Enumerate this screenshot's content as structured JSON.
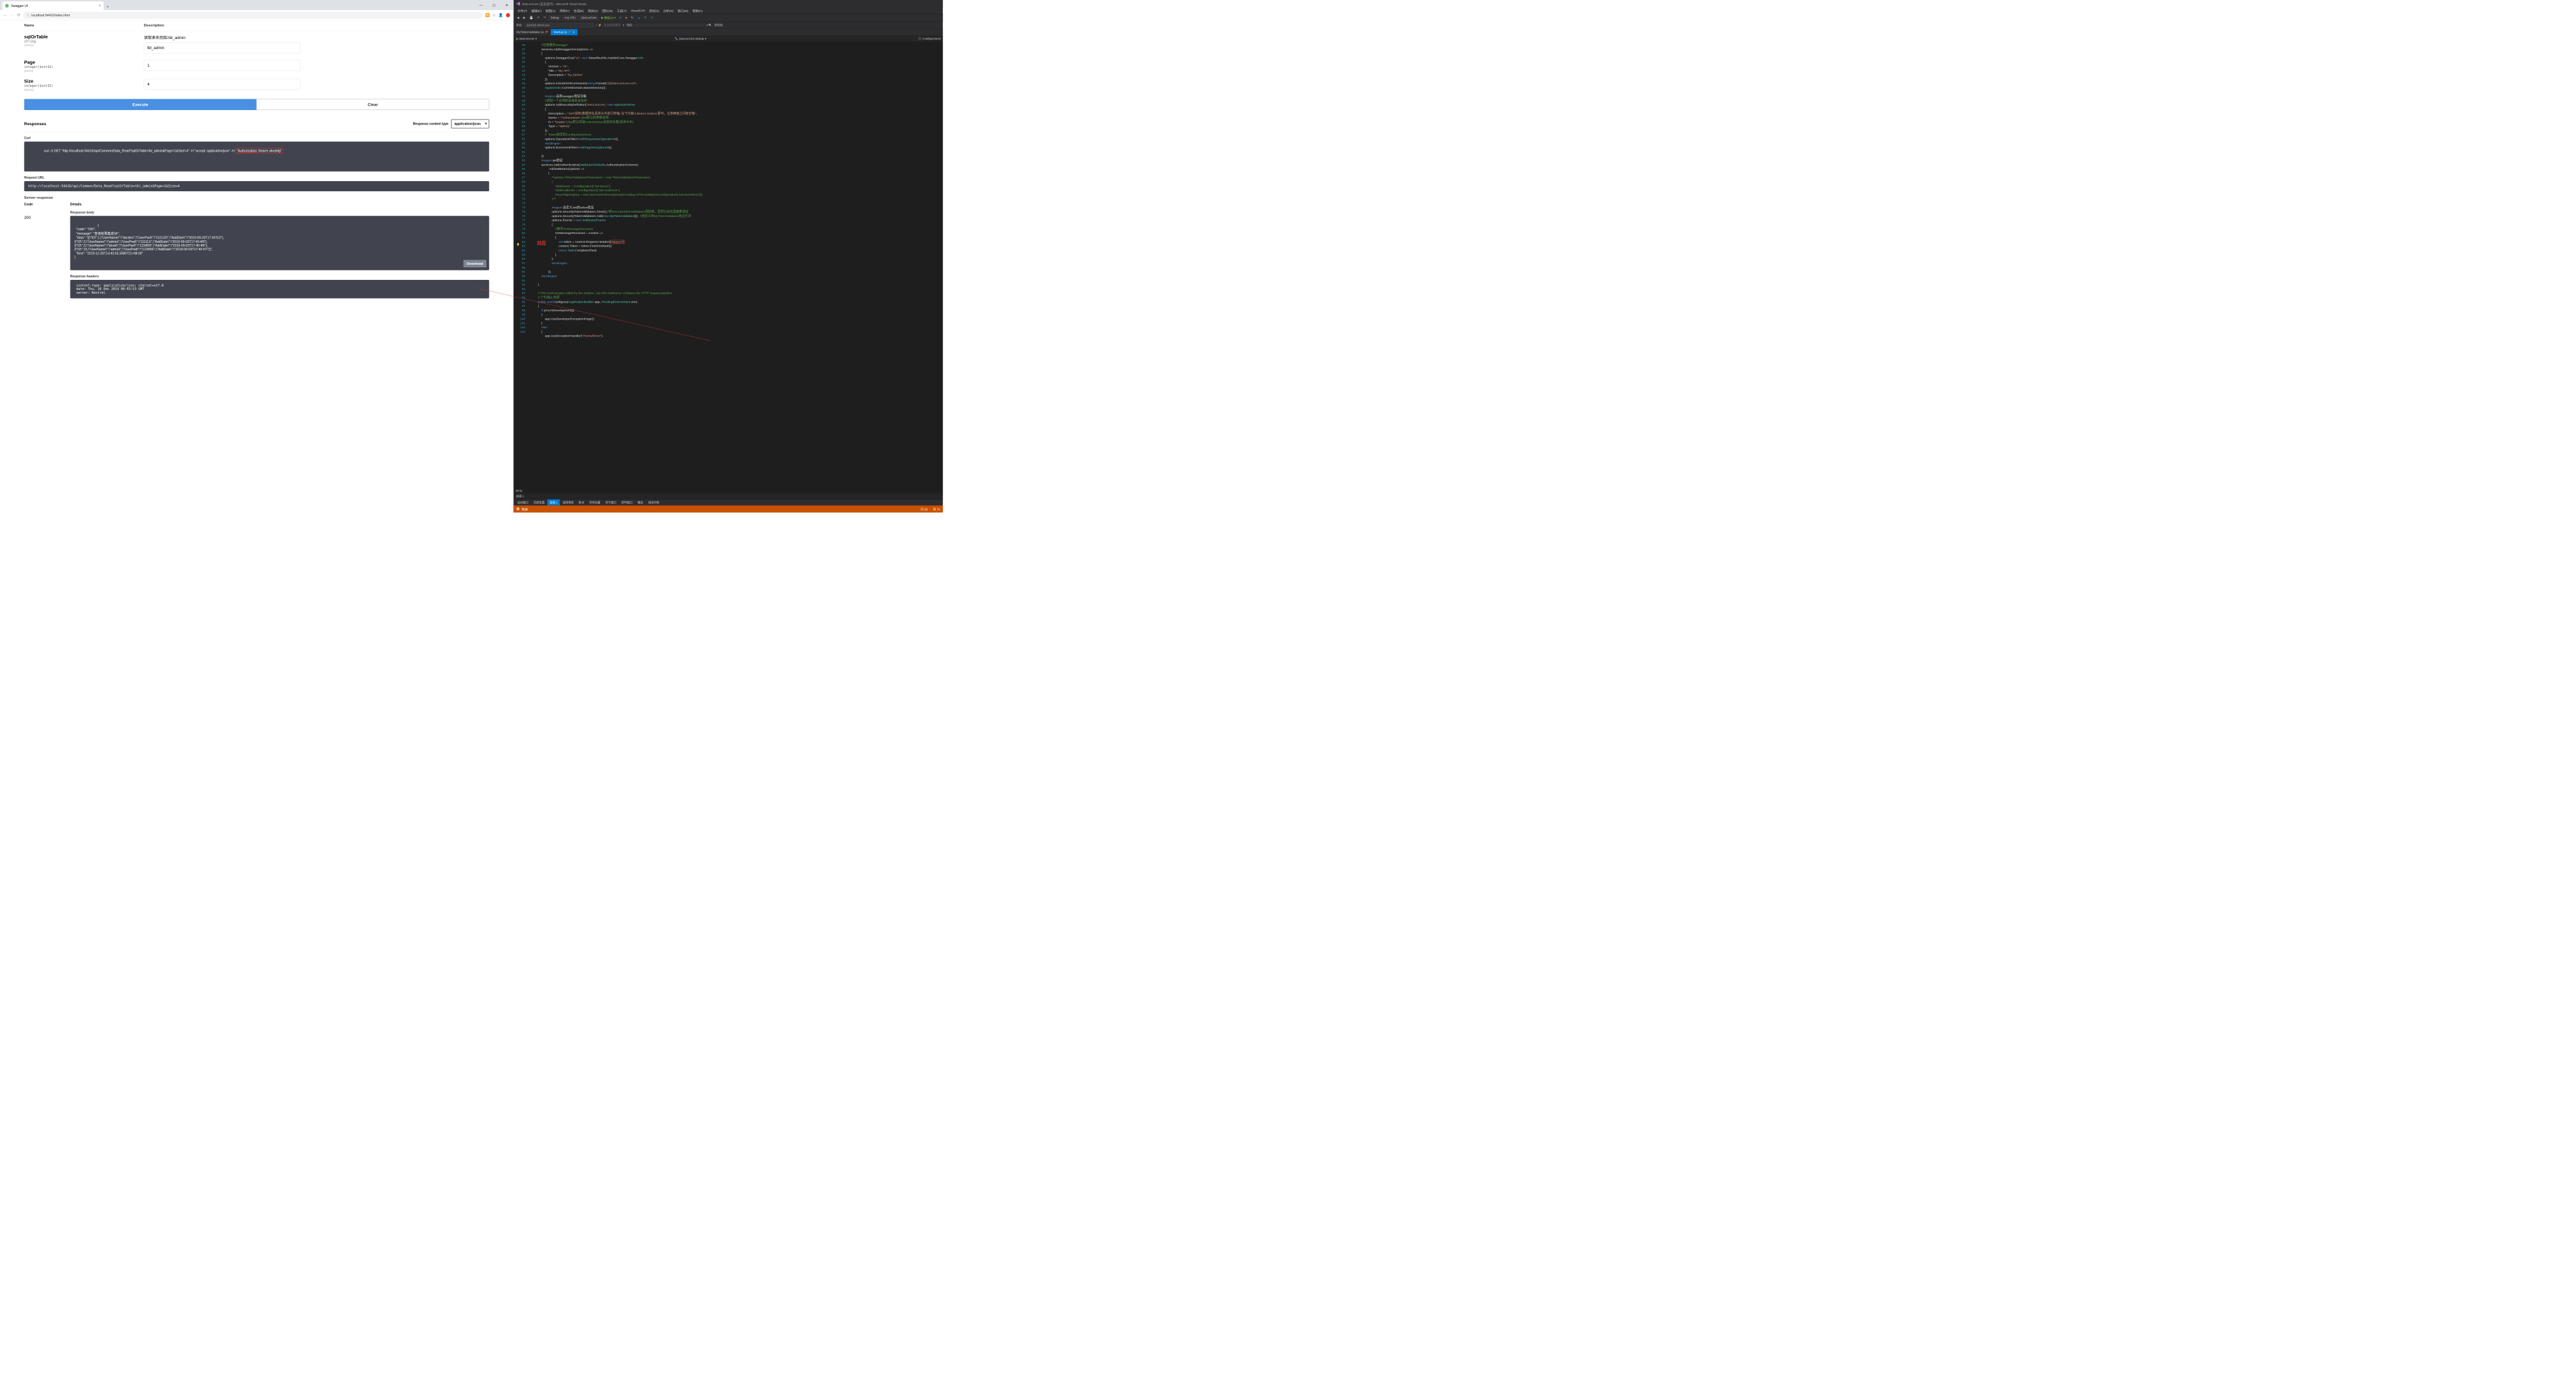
{
  "browser": {
    "tab_title": "Swagger UI",
    "url_secure_text": "ⓘ",
    "url": "localhost:54410/index.html"
  },
  "swagger": {
    "th_name": "Name",
    "th_desc": "Description",
    "params": [
      {
        "name": "sqlOrTable",
        "type": "string",
        "in": "(query)",
        "desc": "读取表名例如:tbl_admin",
        "value": "tbl_admin"
      },
      {
        "name": "Page",
        "type": "integer($int32)",
        "in": "(query)",
        "desc": "",
        "value": "1"
      },
      {
        "name": "Size",
        "type": "integer($int32)",
        "in": "(query)",
        "desc": "",
        "value": "4"
      }
    ],
    "execute": "Execute",
    "clear": "Clear",
    "responses_title": "Responses",
    "rct_label": "Response content type",
    "rct_value": "application/json",
    "curl_label": "Curl",
    "curl_pre": "curl -X GET \"http://localhost:54410/api/Common/Data_Read?sqlOrTable=tbl_admin&Page=1&Size=4\" -H \"accept: application/json\" -H ",
    "curl_hilite_open": "\"",
    "curl_hilite_a": "Authorization:",
    "curl_hilite_b": " Bearer abcdefg",
    "curl_hilite_close": "\"",
    "requrl_label": "Request URL",
    "requrl": "http://localhost:54410/api/Common/Data_Read?sqlOrTable=tbl_admin&Page=1&Size=4",
    "server_response": "Server response",
    "code_label": "Code",
    "details_label": "Details",
    "code_value": "200",
    "response_body_label": "Response body",
    "response_body": "{\n  \"code\": \"OK!\",\n  \"message\": \"查询结果集成功!\",\n  \"data\": \"[{\\\"ID\\\":1,\\\"UserName\\\":\\\"darden\\\",\\\"UserPwd\\\":\\\"112133\\\",\\\"AddDate\\\":\\\"2019-09-03T17:40:51\\\"},\n{\\\"ID\\\":2,\\\"UserName\\\":\\\"admin\\\",\\\"UserPwd\\\":\\\"111111\\\",\\\"AddDate\\\":\\\"2019-09-03T17:40:49\\\"},\n{\\\"ID\\\":3,\\\"UserName\\\":\\\"blood\\\",\\\"UserPwd\\\":\\\"123455\\\",\\\"AddDate\\\":\\\"2019-09-03T17:40:49\\\"},\n{\\\"ID\\\":15,\\\"UserName\\\":\\\"admin\\\",\\\"UserPwd\\\":\\\"123456\\\",\\\"AddDate\\\":\\\"2019-09-03T17:40:47\\\"}]\",\n  \"time\": \"2019-12-26T14:43:53.3580721+08:00\"\n}",
    "download": "Download",
    "response_headers_label": "Response headers",
    "response_headers": " content-type: application/json; charset=utf-8\n date: Thu, 26 Dec 2019 06:43:53 GMT\n server: Kestrel"
  },
  "vs": {
    "title": "ZanLveCore (正在运行) - Microsoft Visual Studio",
    "menu": [
      "文件(F)",
      "编辑(E)",
      "视图(V)",
      "项目(P)",
      "生成(B)",
      "调试(D)",
      "团队(M)",
      "工具(T)",
      "VisualSVN",
      "测试(S)",
      "分析(N)",
      "窗口(W)",
      "帮助(H)"
    ],
    "config": "Debug",
    "platform": "Any CPU",
    "startup": "ZanLveCore",
    "continue": "继续(C)",
    "process_label": "进程:",
    "process": "[14020] dotnet.exe",
    "lifecycle": "生命周期事件",
    "thread_label": "线程:",
    "stackframe_label": "堆栈帧:",
    "tabs": [
      {
        "label": "MyTokenValidator.cs",
        "active": false,
        "pinned": true
      },
      {
        "label": "Startup.cs",
        "active": true,
        "pinned": true
      }
    ],
    "bc_left_icon": "C#",
    "bc_left": "ZanLveCore",
    "bc_right": "ZanLveCore.Startup",
    "bc_far_right": "ConfigureServi",
    "line_start": 36,
    "line_end": 103,
    "zoom": "79 %",
    "annotation": "对应",
    "bottom_panel_title": "监视 1",
    "bottom_tabs": [
      "自动窗口",
      "局部变量",
      "监视 1",
      "调用堆栈",
      "断点",
      "异常设置",
      "命令窗口",
      "即时窗口",
      "输出",
      "错误列表"
    ],
    "bottom_active": "监视 1",
    "status_left": "就绪",
    "status_ln": "行 82",
    "status_col": "列 76",
    "code_lines": [
      "                <span class='c-green'>//注册服务Swagger</span>",
      "                services.AddSwaggerGen(options =>",
      "                {",
      "                    options.SwaggerDoc(<span class='c-str'>\"v1\"</span>, <span class='c-kw'>new</span> Swashbuckle.AspNetCore.Swagger.<span class='c-type'>Info</span>",
      "                    {",
      "                        Version = <span class='c-str'>\"v1\"</span>,",
      "                        Title = <span class='c-str'>\"My API\"</span>,",
      "                        Description = <span class='c-str'>\"by Zanlve\"</span>",
      "                    });",
      "                    options.IncludeXmlComments(<span class='c-kw'>string</span>.Format(<span class='c-str'>\"{0}/ZanLveCore.xml\"</span>,",
      "                    <span class='c-type'>AppDomain</span>.CurrentDomain.BaseDirectory));",
      "",
      "                    <span class='c-kw'>#region</span> 启用swagger验证功能",
      "                    <span class='c-green'>//添加一个必须的全局安全信息</span>",
      "                    options.AddSecurityDefinition(<span class='c-str'>\"ZanLveCore\"</span>, <span class='c-kw'>new</span> <span class='c-type'>ApiKeyScheme</span>",
      "                    {",
      "                        Description = <span class='c-str'>\"JWT授权(数据将在请求头中进行传输) 在下方输入Bearer {token} 即可，注意两者之间有空格\"</span>,",
      "                        Name = <span class='c-str'>\"Authorization\"</span>,<span class='c-green'>//jwt默认的参数名称</span>",
      "                        In = <span class='c-str'>\"header\"</span>,<span class='c-green'>//jwt默认存放Authorization信息的位置(请求头中)</span>",
      "                        Type = <span class='c-str'>\"apiKey\"</span>",
      "                    });",
      "                    <span class='c-green'>//  Token绑定到ConfigureServices</span>",
      "                    options.OperationFilter&lt;<span class='c-type'>AuthResponsesOperation</span>&gt;();",
      "                    <span class='c-kw'>#endregion</span>",
      "                    options.DocumentFilter&lt;<span class='c-type'>AuthTagDescriptions</span>&gt;();",
      "",
      "                });",
      "                <span class='c-kw'>#region</span> jwt验证",
      "                services.AddAuthentication(<span class='c-type'>JwtBearerDefaults</span>.AuthenticationScheme)",
      "                        .AddJwtBearer(options =>",
      "                        {",
      "                            <span class='c-green'>/*options.TokenValidationParameters = new TokenValidationParameters</span>",
      "<span class='c-green'>                            {</span>",
      "<span class='c-green'>                                ValidIssuer = Configuration[\"Jwt:Issuer\"],</span>",
      "<span class='c-green'>                                ValidAudience = Configuration[\"Jwt:Audience\"],</span>",
      "<span class='c-green'>                                IssuerSigningKey = new SymmetricSecurityKey(Encoding.UTF8.GetBytes(Configuration[\"Jwt:SecretKey\"]))</span>",
      "<span class='c-green'>                            };*/</span>",
      "",
      "                            <span class='c-kw'>#region</span> 自定义Jwt的token验证",
      "                            options.SecurityTokenValidators.Clear();<span class='c-green'>//将SecurityTokenValidators清除掉，否则它会在里面拿验证</span>",
      "                            options.SecurityTokenValidators.Add(<span class='c-kw'>new</span> <span class='c-type'>MyTokenValidator</span>());  <span class='c-green'>//自定义的MyTokenValidator验证方法</span>",
      "                            options.Events = <span class='c-kw'>new</span> <span class='c-type'>JwtBearerEvents</span>",
      "                            {",
      "                                <span class='c-green'>//重写OnMessageReceived</span>",
      "                                OnMessageReceived = context =>",
      "                                {",
      "                                    <span class='c-kw'>var</span> token = context.Request.Headers<span class='ann-box'>[<span class='c-str'>\"<span class='ann-ul'>Bearer</span>\"</span>];</span>",
      "                                    context.Token = token.FirstOrDefault();",
      "                                    <span class='c-kw'>return</span> <span class='c-type'>Task</span>.CompletedTask;",
      "                                }",
      "                            };",
      "                            <span class='c-kw'>#endregion</span>",
      "",
      "                        });",
      "                <span class='c-kw'>#endregion</span>",
      "",
      "            }",
      "",
      "            <span class='c-green'>// This method gets called by the runtime. Use this method to configure the HTTP request pipeline.</span>",
      "            <span class='c-green'>// 个引用|0 异常</span>",
      "            <span class='c-kw'>public void</span> Configure(<span class='c-type'>IApplicationBuilder</span> app, <span class='c-type'>IHostingEnvironment</span> env)",
      "            {",
      "                <span class='c-kw'>if</span> (env.IsDevelopment())",
      "                {",
      "                    app.UseDeveloperExceptionPage();",
      "                }",
      "                <span class='c-kw'>else</span>",
      "                {",
      "                    app.UseExceptionHandler(<span class='c-str'>\"/Home/Error\"</span>);"
    ]
  }
}
